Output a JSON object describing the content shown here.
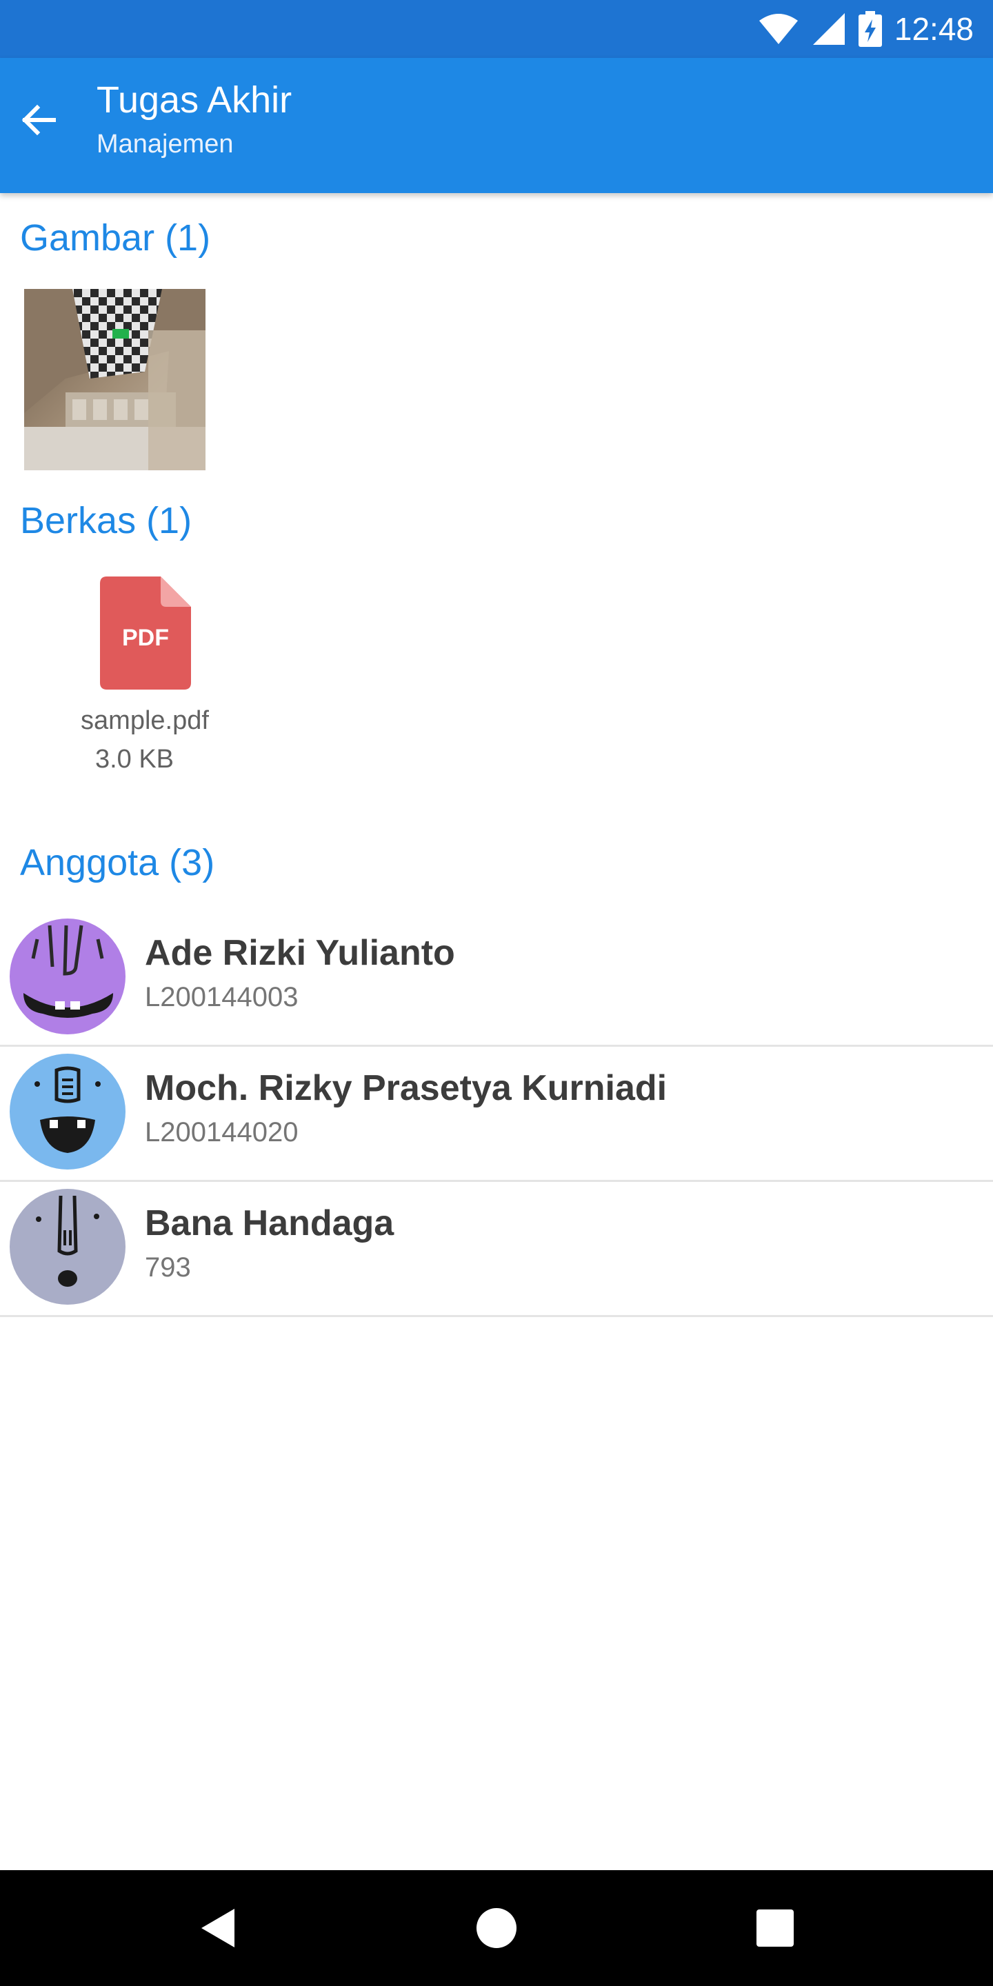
{
  "status_bar": {
    "time": "12:48",
    "icons": [
      "wifi-icon",
      "cell-signal-icon",
      "battery-charging-icon"
    ]
  },
  "app_bar": {
    "title": "Tugas Akhir",
    "subtitle": "Manajemen",
    "back_icon": "arrow-back-icon"
  },
  "colors": {
    "status_bar": "#1e74d2",
    "app_bar": "#1e88e5",
    "section_header": "#1e88e5",
    "pdf": "#e05a5a"
  },
  "images_section": {
    "header": "Gambar (1)"
  },
  "files_section": {
    "header": "Berkas (1)",
    "files": [
      {
        "icon_label": "PDF",
        "name": "sample.pdf",
        "size": "3.0 KB"
      }
    ]
  },
  "members_section": {
    "header": "Anggota (3)",
    "members": [
      {
        "name": "Ade Rizki Yulianto",
        "id": "L200144003",
        "avatar_color": "#b07fe6"
      },
      {
        "name": "Moch. Rizky Prasetya Kurniadi",
        "id": "L200144020",
        "avatar_color": "#7ab8ee"
      },
      {
        "name": "Bana Handaga",
        "id": "793",
        "avatar_color": "#a9adc7"
      }
    ]
  },
  "nav_bar": {
    "buttons": [
      "nav-back-icon",
      "nav-home-icon",
      "nav-recents-icon"
    ]
  }
}
